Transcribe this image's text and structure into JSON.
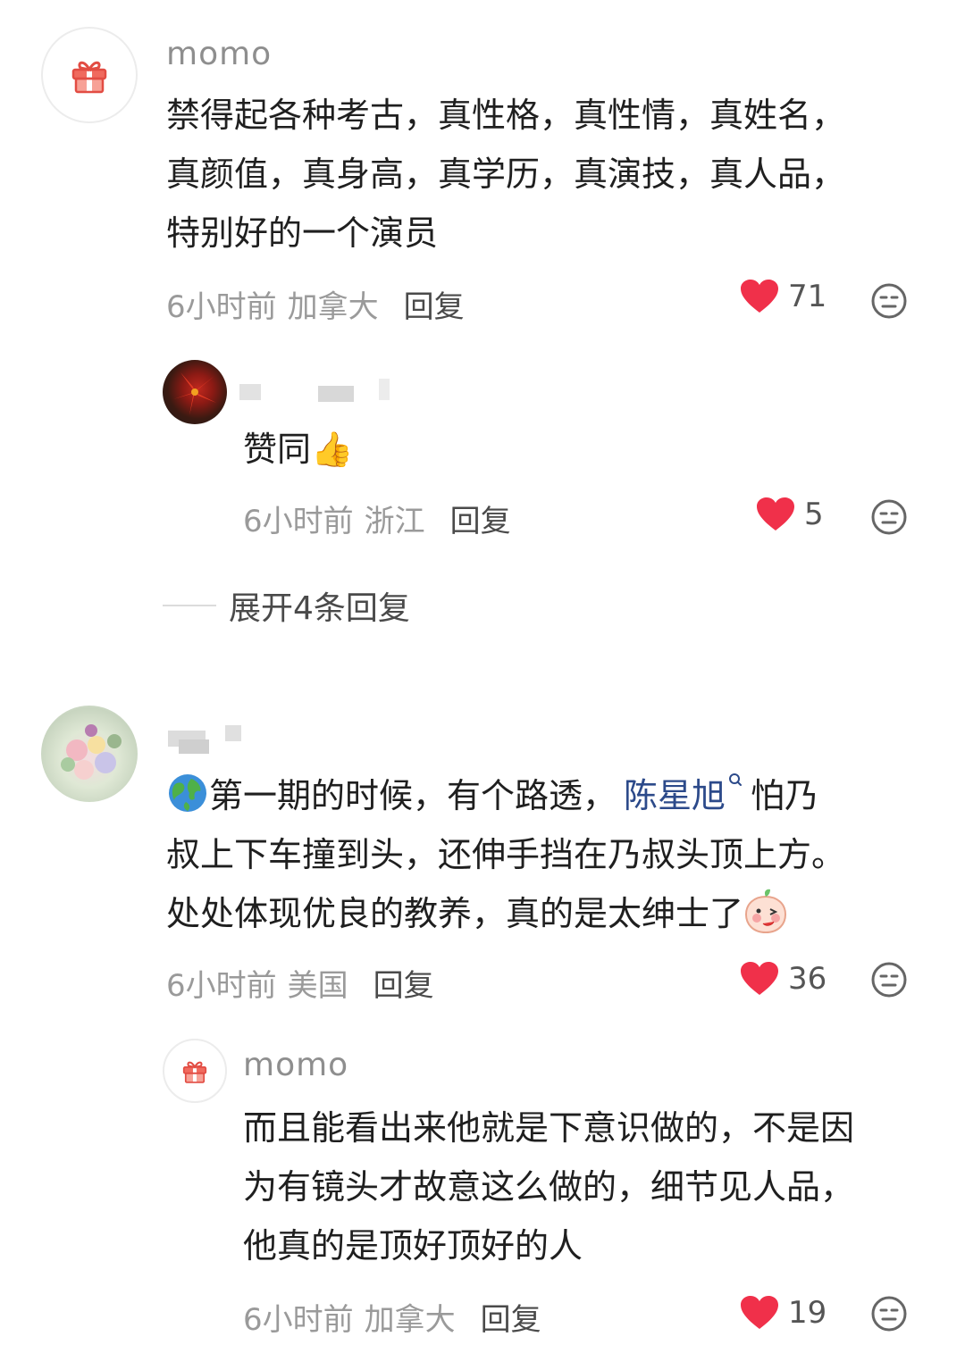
{
  "comments": [
    {
      "username": "momo",
      "text_lines": [
        "禁得起各种考古，真性格，真性情，真姓名，",
        "真颜值，真身高，真学历，真演技，真人品，",
        "特别好的一个演员"
      ],
      "time": "6小时前",
      "location": "加拿大",
      "reply_label": "回复",
      "likes": "71",
      "replies": [
        {
          "username": "",
          "text": "赞同",
          "text_emoji": "👍",
          "time": "6小时前",
          "location": "浙江",
          "reply_label": "回复",
          "likes": "5"
        }
      ],
      "expand_label": "展开4条回复"
    },
    {
      "username": "",
      "line1_prefix": "第一期的时候，有个路透，",
      "mention": "陈星旭",
      "line1_suffix": "怕乃",
      "line2": "叔上下车撞到头，还伸手挡在乃叔头顶上方。",
      "line3": "处处体现优良的教养，真的是太绅士了",
      "time": "6小时前",
      "location": "美国",
      "reply_label": "回复",
      "likes": "36",
      "replies": [
        {
          "username": "momo",
          "text_lines": [
            "而且能看出来他就是下意识做的，不是因",
            "为有镜头才故意这么做的，细节见人品，",
            "他真的是顶好顶好的人"
          ],
          "time": "6小时前",
          "location": "加拿大",
          "reply_label": "回复",
          "likes": "19"
        }
      ]
    }
  ],
  "colors": {
    "heart": "#f0304a",
    "mention": "#2c4a8a",
    "meta": "#9a9a9a"
  },
  "icons": [
    "gift-icon",
    "heart-icon",
    "emoji-reaction-icon",
    "globe-icon",
    "thumbs-up-icon",
    "search-mini-icon",
    "peach-blush-emoji-icon"
  ]
}
